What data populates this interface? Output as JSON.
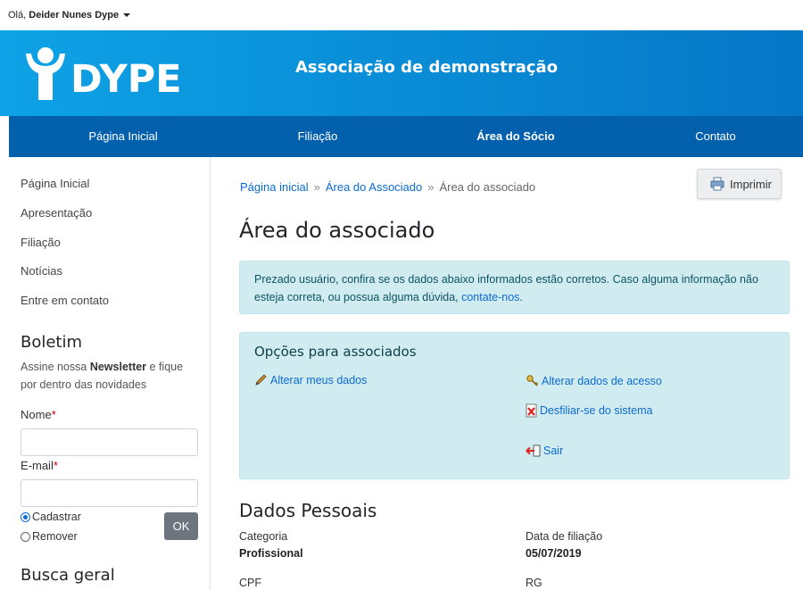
{
  "topbar": {
    "greeting": "Olá,",
    "user": "Deider Nunes Dype"
  },
  "header": {
    "logo_text": "DYPE",
    "site_title": "Associação de demonstração"
  },
  "nav": [
    {
      "label": "Página Inicial",
      "active": false
    },
    {
      "label": "Filiação",
      "active": false
    },
    {
      "label": "Área do Sócio",
      "active": true
    },
    {
      "label": "Contato",
      "active": false
    }
  ],
  "sidebar": {
    "links": [
      "Página Inicial",
      "Apresentação",
      "Filiação",
      "Notícias",
      "Entre em contato"
    ],
    "newsletter": {
      "title": "Boletim",
      "text_before": "Assine nossa ",
      "text_bold": "Newsletter",
      "text_after": " e fique por dentro das novidades",
      "name_label": "Nome",
      "email_label": "E-mail",
      "required_mark": "*",
      "radio_subscribe": "Cadastrar",
      "radio_remove": "Remover",
      "ok_label": "OK"
    },
    "search_title": "Busca geral"
  },
  "main": {
    "breadcrumb": {
      "home": "Página inicial",
      "sep": "»",
      "area": "Área do Associado",
      "current": "Área do associado"
    },
    "print_label": "Imprimir",
    "page_title": "Área do associado",
    "alert": {
      "text": "Prezado usuário, confira se os dados abaixo informados estão corretos. Caso alguma informação não esteja correta, ou possua alguma dúvida, ",
      "link": "contate-nos",
      "end": "."
    },
    "options": {
      "title": "Opções para associados",
      "edit_data": "Alterar meus dados",
      "edit_access": "Alterar dados de acesso",
      "unsubscribe": "Desfiliar-se do sistema",
      "logout": "Sair"
    },
    "personal": {
      "title": "Dados Pessoais",
      "category_label": "Categoria",
      "category_value": "Profissional",
      "date_label": "Data de filiação",
      "date_value": "05/07/2019",
      "cpf_label": "CPF",
      "rg_label": "RG"
    }
  },
  "colors": {
    "header_blue": "#0a8fd8",
    "nav_blue": "#0360ad",
    "link_blue": "#0b6ad0",
    "alert_bg": "#d1ecf1"
  }
}
